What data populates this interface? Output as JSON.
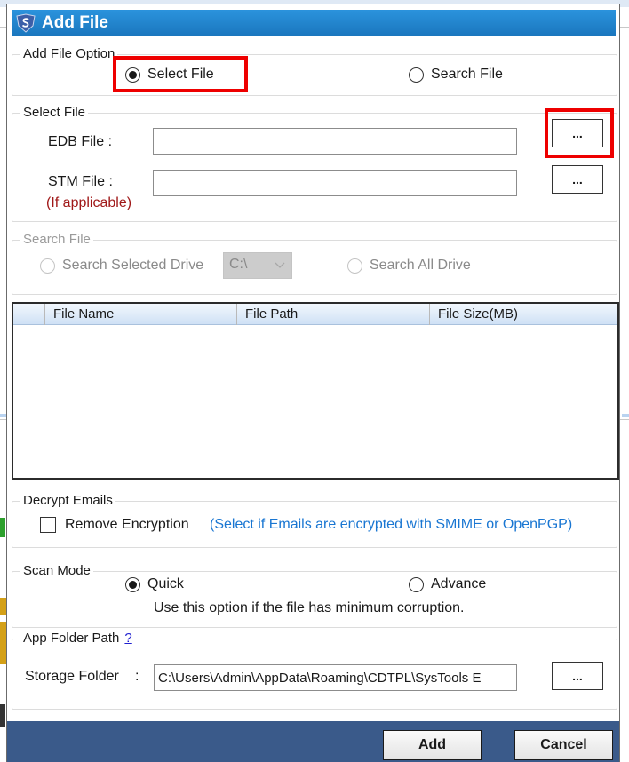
{
  "dialog": {
    "title": "Add File",
    "icon": "systools-shield-icon"
  },
  "add_file_option": {
    "legend": "Add File Option",
    "options": [
      {
        "label": "Select File",
        "checked": true
      },
      {
        "label": "Search File",
        "checked": false
      }
    ]
  },
  "select_file": {
    "legend": "Select File",
    "edb_label": "EDB File :",
    "edb_value": "",
    "stm_label": "STM File :",
    "stm_note": "(If applicable)",
    "stm_value": "",
    "browse_label": "..."
  },
  "search_file": {
    "legend": "Search File",
    "selected_drive_label": "Search Selected Drive",
    "drive_value": "C:\\",
    "all_drive_label": "Search All Drive",
    "enabled": false
  },
  "file_list": {
    "columns": [
      "File Name",
      "File Path",
      "File Size(MB)"
    ],
    "rows": []
  },
  "decrypt": {
    "legend": "Decrypt Emails",
    "checkbox_label": "Remove Encryption",
    "checked": false,
    "hint": "(Select if Emails are encrypted with SMIME or OpenPGP)"
  },
  "scan_mode": {
    "legend": "Scan Mode",
    "options": [
      {
        "label": "Quick",
        "checked": true
      },
      {
        "label": "Advance",
        "checked": false
      }
    ],
    "description": "Use this option if the file has minimum corruption."
  },
  "app_folder": {
    "legend": "App Folder Path",
    "help": "?",
    "storage_label": "Storage Folder",
    "separator": ":",
    "storage_value": "C:\\Users\\Admin\\AppData\\Roaming\\CDTPL\\SysTools E",
    "browse_label": "..."
  },
  "footer": {
    "add_label": "Add",
    "cancel_label": "Cancel"
  },
  "colors": {
    "title_bar": "#1f82cc",
    "highlight": "#ee0000",
    "footer": "#3a5a8a",
    "hint_blue": "#1976d2",
    "note_red": "#a01818"
  }
}
